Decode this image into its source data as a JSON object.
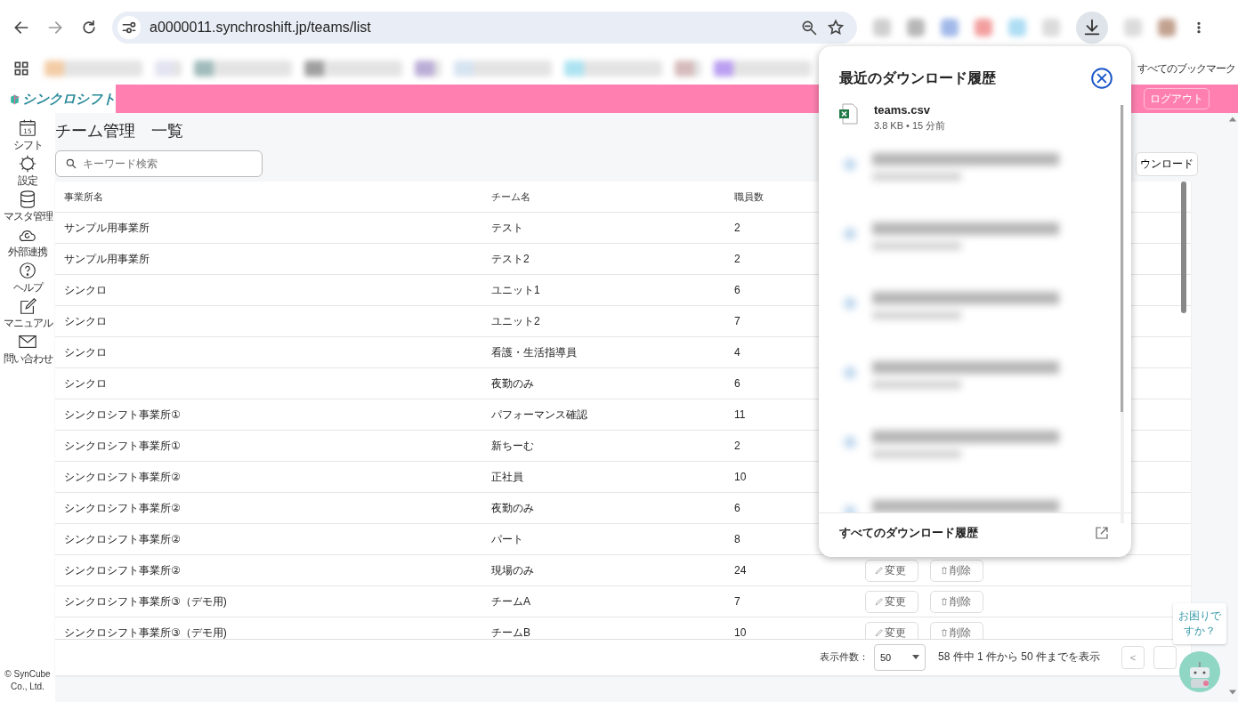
{
  "browser": {
    "url": "a0000011.synchroshift.jp/teams/list",
    "bookmarks_label": "すべてのブックマーク"
  },
  "app": {
    "logo_text": "シンクロシフト",
    "logout": "ログアウト",
    "sidebar": [
      {
        "label": "シフト",
        "kind": "calendar",
        "icon_text": "15"
      },
      {
        "label": "設定",
        "kind": "gear"
      },
      {
        "label": "マスタ管理",
        "kind": "database"
      },
      {
        "label": "外部連携",
        "kind": "cloud"
      },
      {
        "label": "ヘルプ",
        "kind": "help"
      },
      {
        "label": "マニュアル",
        "kind": "edit"
      },
      {
        "label": "問い合わせ",
        "kind": "mail"
      }
    ],
    "copyright": "© SynCube Co., Ltd.",
    "page_title": "チーム管理　一覧",
    "search": {
      "placeholder": "キーワード検索"
    },
    "download_button": "ウンロード",
    "table": {
      "columns": [
        "事業所名",
        "チーム名",
        "職員数"
      ],
      "rows": [
        {
          "cells": [
            "サンプル用事業所",
            "テスト",
            "2"
          ]
        },
        {
          "cells": [
            "サンプル用事業所",
            "テスト2",
            "2"
          ]
        },
        {
          "cells": [
            "シンクロ",
            "ユニット1",
            "6"
          ]
        },
        {
          "cells": [
            "シンクロ",
            "ユニット2",
            "7"
          ]
        },
        {
          "cells": [
            "シンクロ",
            "看護・生活指導員",
            "4"
          ]
        },
        {
          "cells": [
            "シンクロ",
            "夜勤のみ",
            "6"
          ]
        },
        {
          "cells": [
            "シンクロシフト事業所①",
            "パフォーマンス確認",
            "11"
          ]
        },
        {
          "cells": [
            "シンクロシフト事業所①",
            "新ちーむ",
            "2"
          ]
        },
        {
          "cells": [
            "シンクロシフト事業所②",
            "正社員",
            "10"
          ]
        },
        {
          "cells": [
            "シンクロシフト事業所②",
            "夜勤のみ",
            "6"
          ]
        },
        {
          "cells": [
            "シンクロシフト事業所②",
            "パート",
            "8"
          ]
        },
        {
          "cells": [
            "シンクロシフト事業所②",
            "現場のみ",
            "24"
          ],
          "actions": [
            "変更",
            "削除"
          ]
        },
        {
          "cells": [
            "シンクロシフト事業所③（デモ用)",
            "チームA",
            "7"
          ],
          "actions": [
            "変更",
            "削除"
          ]
        },
        {
          "cells": [
            "シンクロシフト事業所③（デモ用)",
            "チームB",
            "10"
          ],
          "actions": [
            "変更",
            "削除"
          ]
        }
      ]
    },
    "footer": {
      "per_page_label": "表示件数：",
      "per_page_value": "50",
      "range_text": "58 件中 1 件から 50 件までを表示",
      "prev": "<"
    },
    "help_bubble": "お困りですか？"
  },
  "download_panel": {
    "title": "最近のダウンロード履歴",
    "items": [
      {
        "kind": "file",
        "name": "teams.csv",
        "meta": "3.8 KB • 15 分前"
      },
      {
        "kind": "blurred"
      },
      {
        "kind": "blurred"
      },
      {
        "kind": "blurred"
      },
      {
        "kind": "blurred"
      },
      {
        "kind": "blurred"
      },
      {
        "kind": "blurred"
      }
    ],
    "footer_link": "すべてのダウンロード履歴"
  }
}
